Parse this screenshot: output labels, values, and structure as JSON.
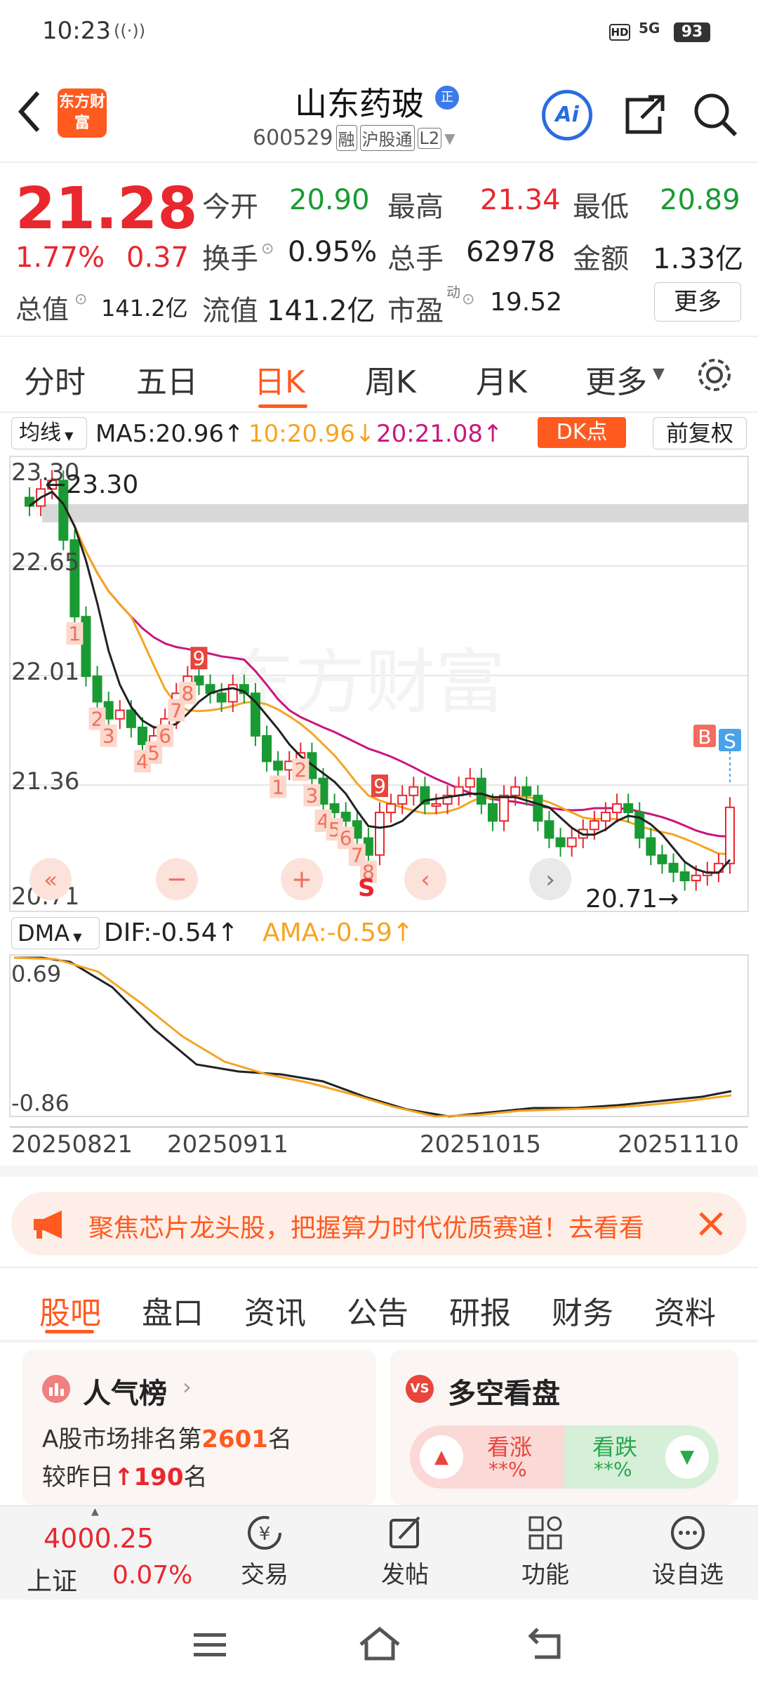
{
  "status_bar": {
    "time": "10:23",
    "battery": "93",
    "net": "5G"
  },
  "header": {
    "logo": "东方财富",
    "stock_name": "山东药玻",
    "badge": "正",
    "code": "600529",
    "tag1": "融",
    "tag2": "沪股通",
    "tag3": "L2",
    "ai": "Ai"
  },
  "quote": {
    "price": "21.28",
    "pct": "1.77%",
    "chg": "0.37",
    "open_label": "今开",
    "open": "20.90",
    "high_label": "最高",
    "high": "21.34",
    "low_label": "最低",
    "low": "20.89",
    "turnover_label": "换手",
    "turnover": "0.95%",
    "vol_label": "总手",
    "vol": "62978",
    "amt_label": "金额",
    "amt": "1.33亿",
    "mcap_label": "总值",
    "mcap": "141.2亿",
    "float_label": "流值",
    "float": "141.2亿",
    "pe_label": "市盈",
    "pe_sup": "动",
    "pe": "19.52",
    "more": "更多"
  },
  "chart_tabs": [
    "分时",
    "五日",
    "日K",
    "周K",
    "月K",
    "更多"
  ],
  "active_tab": "日K",
  "ma_bar": {
    "select": "均线",
    "ma5": "MA5:20.96↑",
    "ma10": "10:20.96↓",
    "ma20": "20:21.08↑",
    "dk": "DK点",
    "adj": "前复权"
  },
  "kline": {
    "y_labels": [
      "23.30",
      "22.65",
      "22.01",
      "21.36",
      "20.71"
    ],
    "high_marker": "23.30",
    "low_marker": "20.71",
    "watermark": "东方财富",
    "buy": "B",
    "sell": "S",
    "td_labels": [
      "1",
      "2",
      "3",
      "4",
      "5",
      "6",
      "7",
      "8",
      "9",
      "1",
      "2",
      "3",
      "4",
      "5",
      "6",
      "7",
      "8",
      "9"
    ]
  },
  "dma": {
    "select": "DMA",
    "dif": "DIF:-0.54↑",
    "ama": "AMA:-0.59↑",
    "y_top": "0.69",
    "y_bottom": "-0.86"
  },
  "x_dates": [
    "20250821",
    "20250911",
    "20251015",
    "20251110"
  ],
  "banner": {
    "text": "聚焦芯片龙头股，把握算力时代优质赛道！去看看"
  },
  "info_tabs": [
    "股吧",
    "盘口",
    "资讯",
    "公告",
    "研报",
    "财务",
    "资料"
  ],
  "cards": {
    "left_title": "人气榜",
    "left_line1_pre": "A股市场排名第",
    "left_line1_num": "2601",
    "left_line1_post": "名",
    "left_line2_pre": "较昨日",
    "left_line2_num": "190",
    "left_line2_post": "名",
    "right_title": "多空看盘",
    "bull": "看涨",
    "bull_val": "**%",
    "bear": "看跌",
    "bear_val": "**%"
  },
  "bottom_nav": {
    "index_val": "4000.25",
    "index_name": "上证",
    "index_pct": "0.07%",
    "trade": "交易",
    "post": "发帖",
    "func": "功能",
    "watch": "设自选"
  },
  "colors": {
    "red": "#e8272e",
    "green": "#1a9a33",
    "orange": "#f4a522",
    "purple": "#c8177e",
    "brand": "#ff5a1f"
  }
}
